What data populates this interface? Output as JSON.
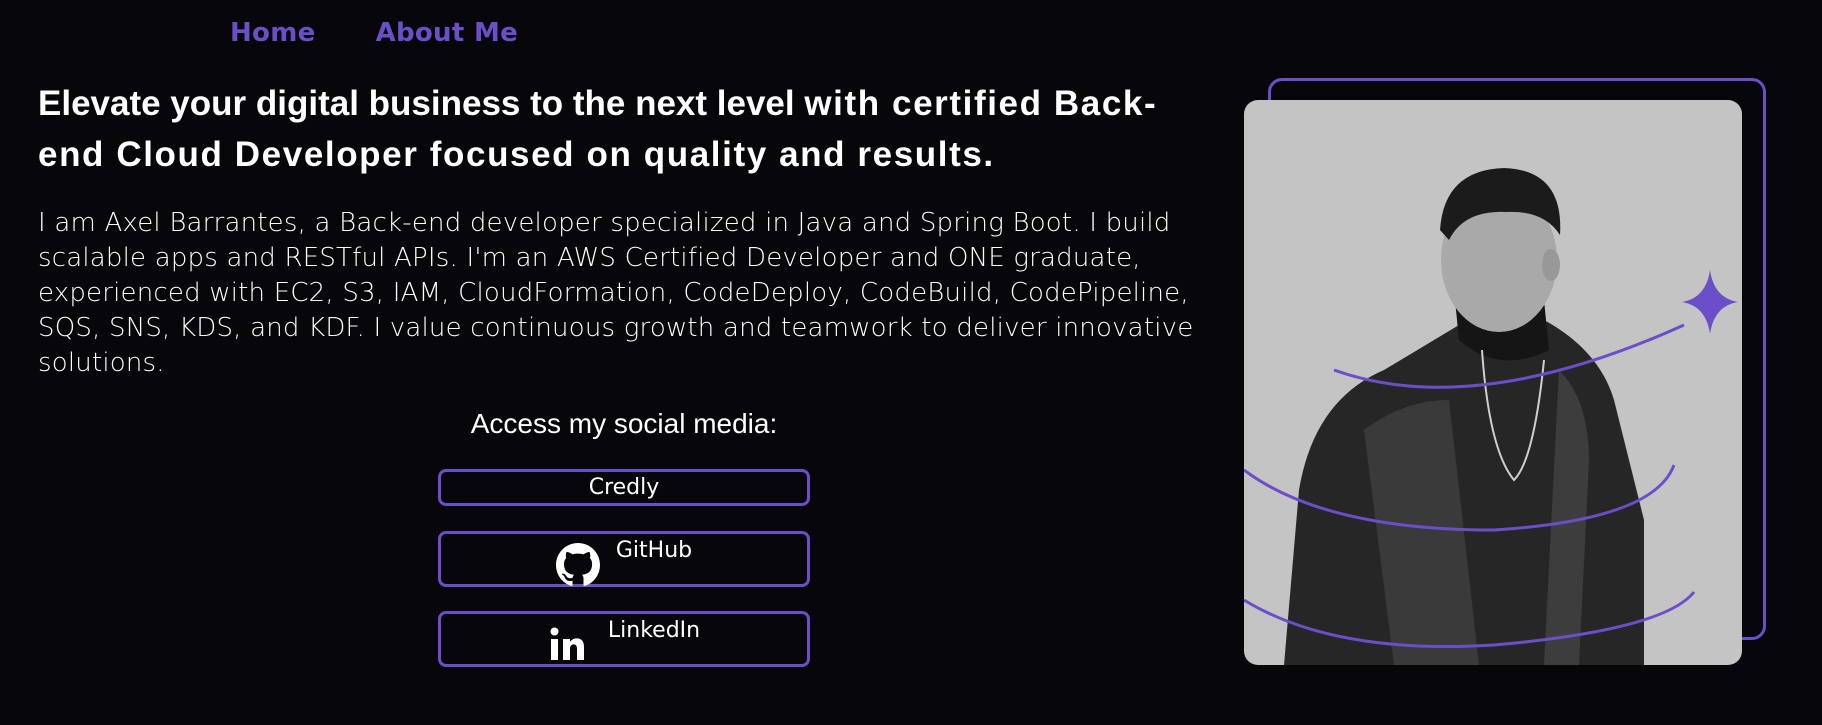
{
  "nav": {
    "home": "Home",
    "about": "About Me"
  },
  "hero": {
    "headline_part1": "Elevate your digital business to the next level ",
    "headline_part2": "with certified Back-end Cloud Developer focused on quality and results.",
    "bio": "I am Axel Barrantes, a Back-end developer specialized in Java and Spring Boot. I build scalable apps and RESTful APIs. I'm an AWS Certified Developer and ONE graduate, experienced with EC2, S3, IAM, CloudFormation, CodeDeploy, CodeBuild, CodePipeline, SQS, SNS, KDS, and KDF. I value continuous growth and teamwork to deliver innovative solutions."
  },
  "social": {
    "title": "Access my social media:",
    "buttons": [
      {
        "label": "Credly",
        "icon": ""
      },
      {
        "label": "GitHub",
        "icon": "github-icon"
      },
      {
        "label": "LinkedIn",
        "icon": "linkedin-icon"
      }
    ]
  },
  "portrait": {
    "icon": "portrait-photo",
    "decoration": "sparkle-star-icon"
  },
  "colors": {
    "background": "#07060b",
    "accent": "#6a4fc9",
    "text": "#ffffff",
    "photo_bg": "#c4c4c4"
  }
}
